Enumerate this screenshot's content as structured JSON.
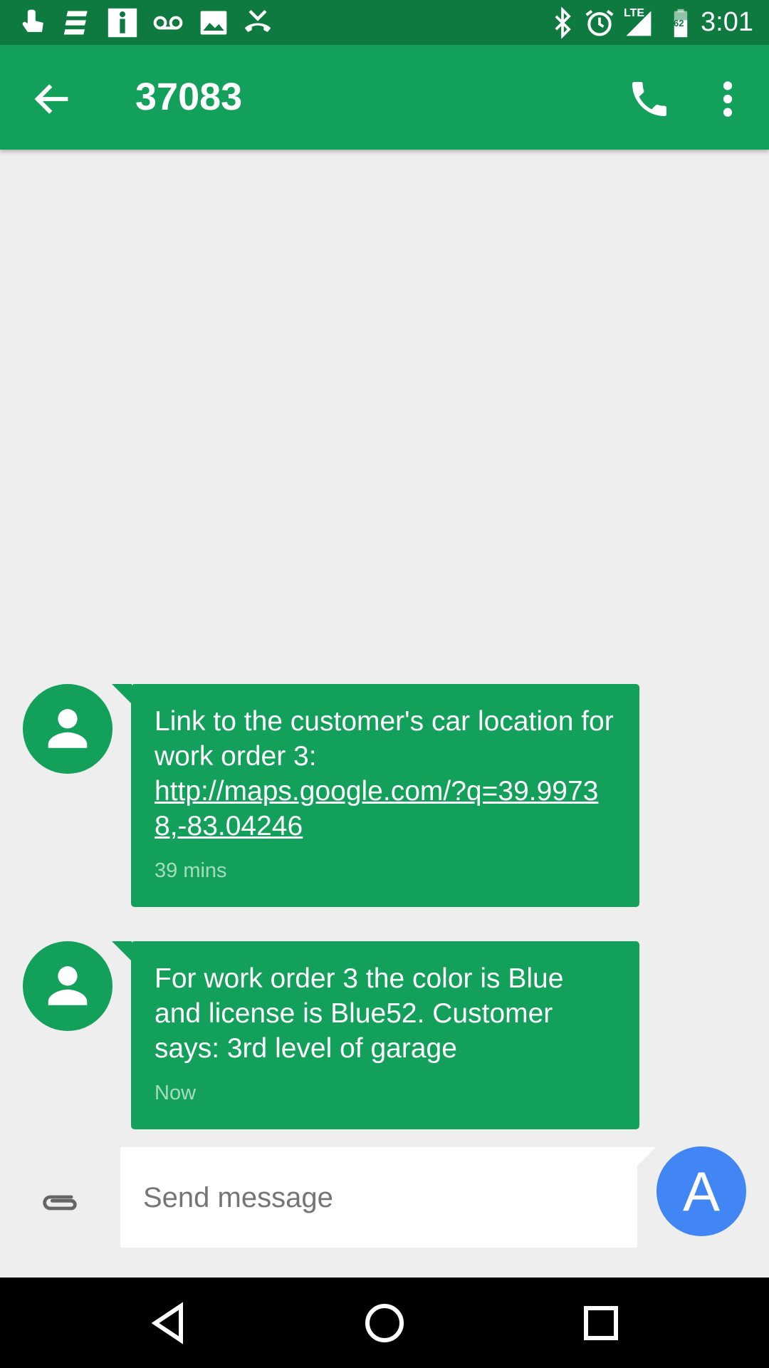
{
  "status_bar": {
    "time": "3:01",
    "network": "LTE",
    "battery_level": "62",
    "left_icons": [
      "touch-icon",
      "list-icon",
      "info-icon",
      "voicemail-icon",
      "image-icon",
      "missed-call-icon"
    ],
    "right_icons": [
      "bluetooth-icon",
      "alarm-icon",
      "signal-icon",
      "battery-icon"
    ]
  },
  "app_bar": {
    "title": "37083",
    "back_icon": "arrow-left-icon",
    "call_icon": "phone-icon",
    "menu_icon": "more-vert-icon"
  },
  "messages": [
    {
      "text": "Link to the customer's car location for work order 3:",
      "link": "http://maps.google.com/?q=39.99738,-83.04246",
      "time": "39 mins"
    },
    {
      "text": "For work order 3 the color is Blue and license is Blue52. Customer says: 3rd level of garage",
      "time": "Now"
    }
  ],
  "compose": {
    "placeholder": "Send message",
    "value": "",
    "send_label": "A"
  },
  "colors": {
    "status_bar": "#0f7a3f",
    "app_bar": "#12a05a",
    "bubble": "#12a05a",
    "send_button": "#4285f4",
    "background": "#eeeeee"
  }
}
